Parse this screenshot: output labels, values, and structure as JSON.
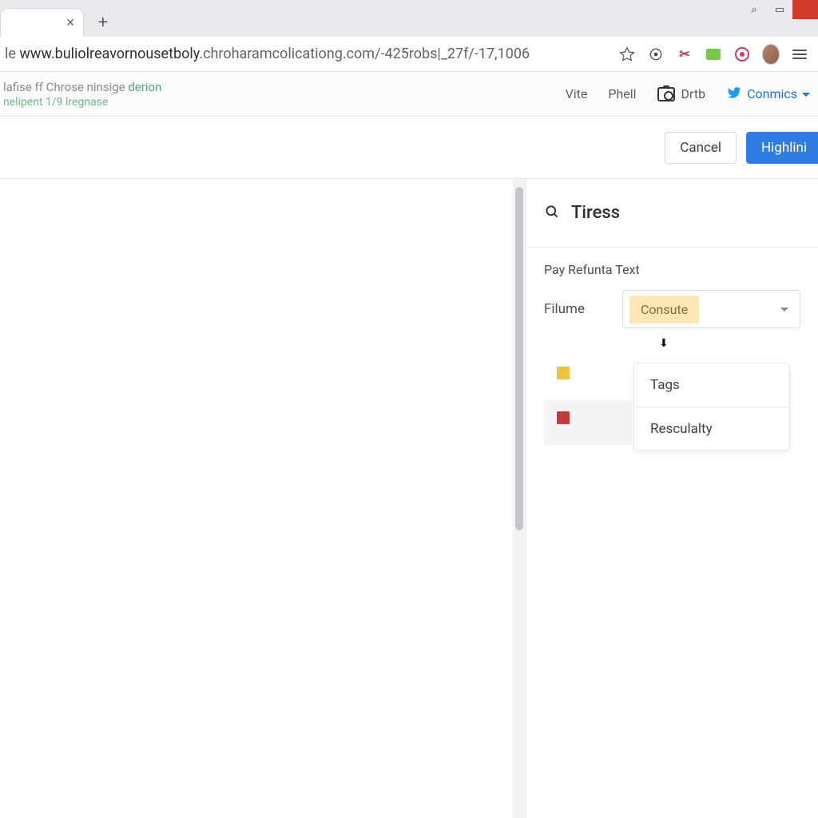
{
  "browser": {
    "url_prefix": "le ",
    "url_host": "www.buliolreavornousetboly",
    "url_path": ".chroharamcolicationg.com/-425robs|_27f/-17,1006",
    "star_title": "Bookmark",
    "menu_title": "Menu"
  },
  "subbar": {
    "line1_muted": "lafise ff Chrose ninsige ",
    "line1_green": "derion",
    "line2": "nelipent 1/9 lregnase",
    "link_vite": "Vite",
    "link_phell": "Phell",
    "link_drtb": "Drtb",
    "link_conmics": "Conmics"
  },
  "actions": {
    "cancel": "Cancel",
    "primary": "Highlini"
  },
  "panel": {
    "title": "Tiress",
    "section_label": "Pay Refunta Text",
    "field_label": "Filume",
    "selected_chip": "Consute",
    "options": [
      "Tags",
      "Resculalty"
    ],
    "legend_colors": {
      "yellow": "#f2c23e",
      "red": "#c53a3f"
    }
  }
}
